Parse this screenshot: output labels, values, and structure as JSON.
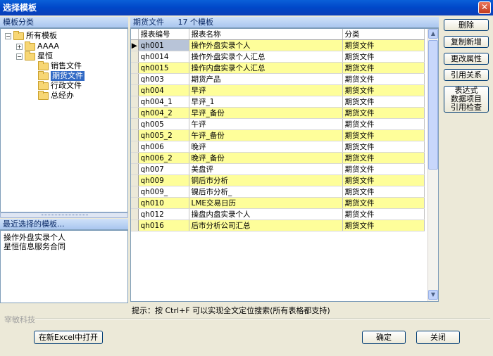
{
  "window": {
    "title": "选择模板",
    "close": "✕"
  },
  "tree": {
    "header": "模板分类",
    "nodes": [
      {
        "label": "所有模板",
        "expander": "−"
      },
      {
        "label": "AAAA",
        "expander": "+"
      },
      {
        "label": "星恒",
        "expander": "−"
      },
      {
        "label": "销售文件"
      },
      {
        "label": "期货文件"
      },
      {
        "label": "行政文件"
      },
      {
        "label": "总经办"
      }
    ]
  },
  "recent": {
    "header": "最近选择的模板...",
    "items": [
      "操作外盘实录个人",
      "星恒信息服务合同"
    ]
  },
  "grid": {
    "header_title": "期货文件",
    "header_count": "17 个模板",
    "columns": [
      "报表编号",
      "报表名称",
      "分类"
    ],
    "rows": [
      {
        "code": "qh001",
        "name": "操作外盘实录个人",
        "cat": "期货文件"
      },
      {
        "code": "qh0014",
        "name": "操作外盘实录个人汇总",
        "cat": "期货文件"
      },
      {
        "code": "qh0015",
        "name": "操作内盘实录个人汇总",
        "cat": "期货文件"
      },
      {
        "code": "qh003",
        "name": "期货产品",
        "cat": "期货文件"
      },
      {
        "code": "qh004",
        "name": "早评",
        "cat": "期货文件"
      },
      {
        "code": "qh004_1",
        "name": "早评_1",
        "cat": "期货文件"
      },
      {
        "code": "qh004_2",
        "name": "早评_备份",
        "cat": "期货文件"
      },
      {
        "code": "qh005",
        "name": "午评",
        "cat": "期货文件"
      },
      {
        "code": "qh005_2",
        "name": "午评_备份",
        "cat": "期货文件"
      },
      {
        "code": "qh006",
        "name": "晚评",
        "cat": "期货文件"
      },
      {
        "code": "qh006_2",
        "name": "晚评_备份",
        "cat": "期货文件"
      },
      {
        "code": "qh007",
        "name": "美盘评",
        "cat": "期货文件"
      },
      {
        "code": "qh009",
        "name": "铜后市分析",
        "cat": "期货文件"
      },
      {
        "code": "qh009_",
        "name": "镍后市分析_",
        "cat": "期货文件"
      },
      {
        "code": "qh010",
        "name": "LME交易日历",
        "cat": "期货文件"
      },
      {
        "code": "qh012",
        "name": "操盘内盘实录个人",
        "cat": "期货文件"
      },
      {
        "code": "qh016",
        "name": "后市分析公司汇总",
        "cat": "期货文件"
      }
    ]
  },
  "side_buttons": {
    "delete": "删除",
    "copy_new": "复制新增",
    "change_props": "更改属性",
    "references": "引用关系",
    "check": "表达式\n数据项目\n引用检查"
  },
  "hint": "提示：按 Ctrl+F 可以实现全文定位搜索(所有表格都支持)",
  "company": "宰敏科技",
  "bottom_buttons": {
    "open_excel": "在新Excel中打开",
    "ok": "确定",
    "close": "关闭"
  }
}
